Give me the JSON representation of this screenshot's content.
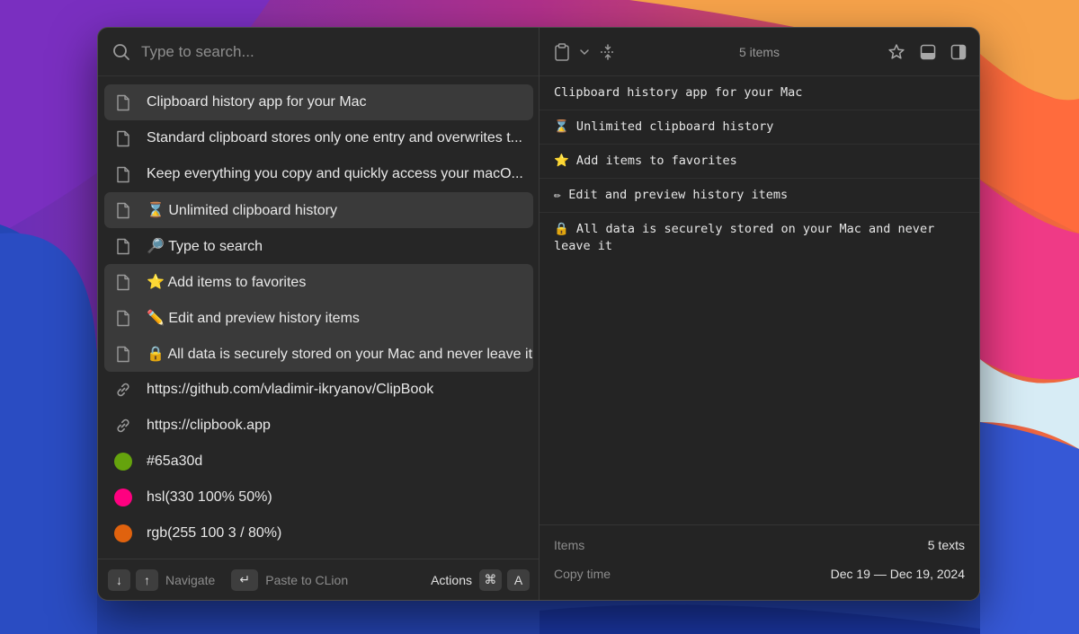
{
  "search": {
    "placeholder": "Type to search..."
  },
  "items": [
    {
      "text": "Clipboard history app for your Mac",
      "icon": "document-icon"
    },
    {
      "text": "Standard clipboard stores only one entry and overwrites t...",
      "icon": "document-icon"
    },
    {
      "text": "Keep everything you copy and quickly access your macO...",
      "icon": "document-icon"
    },
    {
      "text": "⌛ Unlimited clipboard history",
      "icon": "document-icon"
    },
    {
      "text": "🔎 Type to search",
      "icon": "document-icon"
    },
    {
      "text": "⭐ Add items to favorites",
      "icon": "document-icon"
    },
    {
      "text": "✏️ Edit and preview history items",
      "icon": "document-icon"
    },
    {
      "text": "🔒 All data is securely stored on your Mac and never leave it",
      "icon": "document-icon"
    },
    {
      "text": "https://github.com/vladimir-ikryanov/ClipBook",
      "icon": "link-icon"
    },
    {
      "text": "https://clipbook.app",
      "icon": "link-icon"
    },
    {
      "text": "#65a30d",
      "icon": "color-swatch",
      "color": "#65a30d"
    },
    {
      "text": "hsl(330 100% 50%)",
      "icon": "color-swatch",
      "color": "#ff0080"
    },
    {
      "text": "rgb(255 100 3 / 80%)",
      "icon": "color-swatch",
      "color": "#e0620e"
    }
  ],
  "footer": {
    "down_key": "↓",
    "up_key": "↑",
    "navigate_label": "Navigate",
    "enter_key": "↵",
    "paste_label": "Paste to CLion",
    "actions_label": "Actions",
    "cmd_key": "⌘",
    "a_key": "A"
  },
  "toolbar": {
    "count": "5 items"
  },
  "preview": {
    "lines": [
      "Clipboard history app for your Mac",
      "⌛ Unlimited clipboard history",
      "⭐ Add items to favorites",
      "✏ Edit and preview history items",
      "🔒 All data is securely stored on your Mac and never leave it"
    ]
  },
  "details": {
    "items_label": "Items",
    "items_value": "5 texts",
    "copy_time_label": "Copy time",
    "copy_time_value": "Dec 19 — Dec 19, 2024"
  }
}
